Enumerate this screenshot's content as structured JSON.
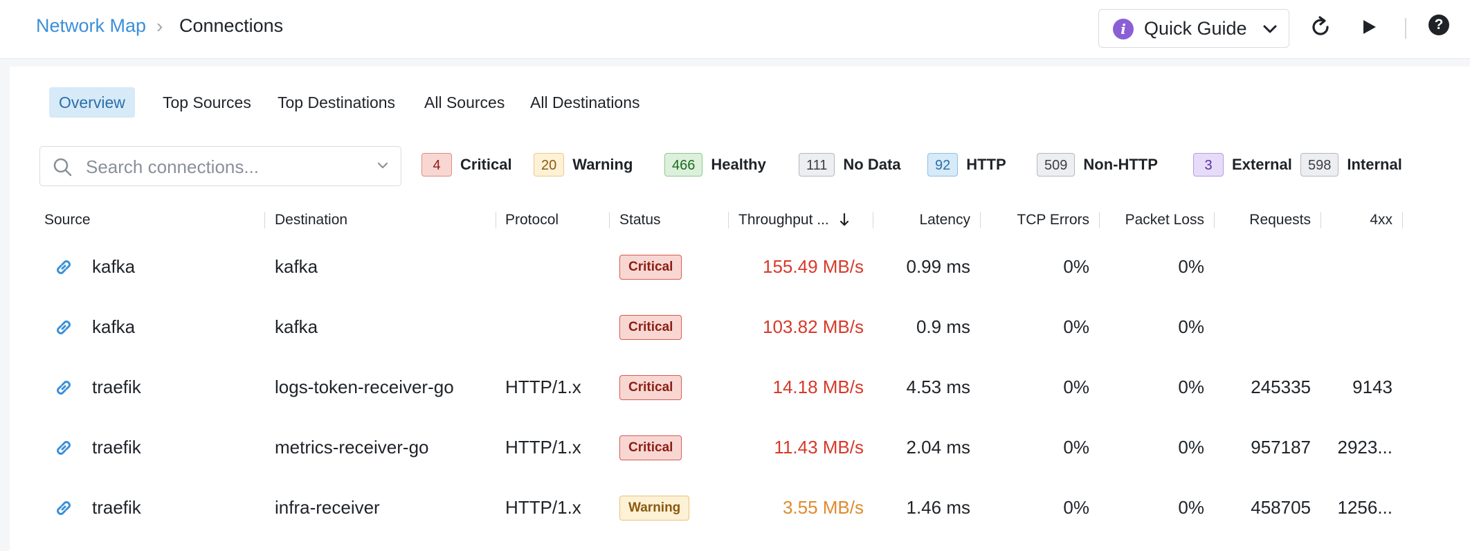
{
  "breadcrumb": {
    "parent": "Network Map",
    "separator": "›",
    "current": "Connections"
  },
  "toolbar": {
    "quick_guide_label": "Quick Guide",
    "help_label": "?"
  },
  "tabs": [
    {
      "label": "Overview",
      "active": true
    },
    {
      "label": "Top Sources",
      "active": false
    },
    {
      "label": "Top Destinations",
      "active": false
    },
    {
      "label": "All Sources",
      "active": false
    },
    {
      "label": "All Destinations",
      "active": false
    }
  ],
  "search": {
    "placeholder": "Search connections...",
    "value": ""
  },
  "filters": [
    {
      "count": "4",
      "label": "Critical"
    },
    {
      "count": "20",
      "label": "Warning"
    },
    {
      "count": "466",
      "label": "Healthy"
    },
    {
      "count": "111",
      "label": "No Data"
    },
    {
      "count": "92",
      "label": "HTTP"
    },
    {
      "count": "509",
      "label": "Non-HTTP"
    },
    {
      "count": "3",
      "label": "External"
    },
    {
      "count": "598",
      "label": "Internal"
    }
  ],
  "columns": {
    "source": "Source",
    "destination": "Destination",
    "protocol": "Protocol",
    "status": "Status",
    "throughput": "Throughput ...",
    "latency": "Latency",
    "tcp_errors": "TCP Errors",
    "packet_loss": "Packet Loss",
    "requests": "Requests",
    "4xx": "4xx"
  },
  "rows": [
    {
      "source": "kafka",
      "destination": "kafka",
      "protocol": "",
      "status": "Critical",
      "throughput": "155.49 MB/s",
      "latency": "0.99 ms",
      "tcp_errors": "0%",
      "packet_loss": "0%",
      "requests": "",
      "4xx": ""
    },
    {
      "source": "kafka",
      "destination": "kafka",
      "protocol": "",
      "status": "Critical",
      "throughput": "103.82 MB/s",
      "latency": "0.9 ms",
      "tcp_errors": "0%",
      "packet_loss": "0%",
      "requests": "",
      "4xx": ""
    },
    {
      "source": "traefik",
      "destination": "logs-token-receiver-go",
      "protocol": "HTTP/1.x",
      "status": "Critical",
      "throughput": "14.18 MB/s",
      "latency": "4.53 ms",
      "tcp_errors": "0%",
      "packet_loss": "0%",
      "requests": "245335",
      "4xx": "9143"
    },
    {
      "source": "traefik",
      "destination": "metrics-receiver-go",
      "protocol": "HTTP/1.x",
      "status": "Critical",
      "throughput": "11.43 MB/s",
      "latency": "2.04 ms",
      "tcp_errors": "0%",
      "packet_loss": "0%",
      "requests": "957187",
      "4xx": "2923..."
    },
    {
      "source": "traefik",
      "destination": "infra-receiver",
      "protocol": "HTTP/1.x",
      "status": "Warning",
      "throughput": "3.55 MB/s",
      "latency": "1.46 ms",
      "tcp_errors": "0%",
      "packet_loss": "0%",
      "requests": "458705",
      "4xx": "1256..."
    }
  ],
  "colors": {
    "link": "#3b8fd9",
    "critical": "#d63a2a",
    "warning": "#e08a2e",
    "active_tab_bg": "#d6eaf8",
    "quick_guide_icon": "#8a5fd6"
  },
  "icons": {
    "quick_guide": "info-icon",
    "refresh": "refresh-icon",
    "play": "play-icon",
    "help": "help-icon",
    "search": "search-icon",
    "row": "link-icon",
    "sort": "sort-desc-icon"
  }
}
